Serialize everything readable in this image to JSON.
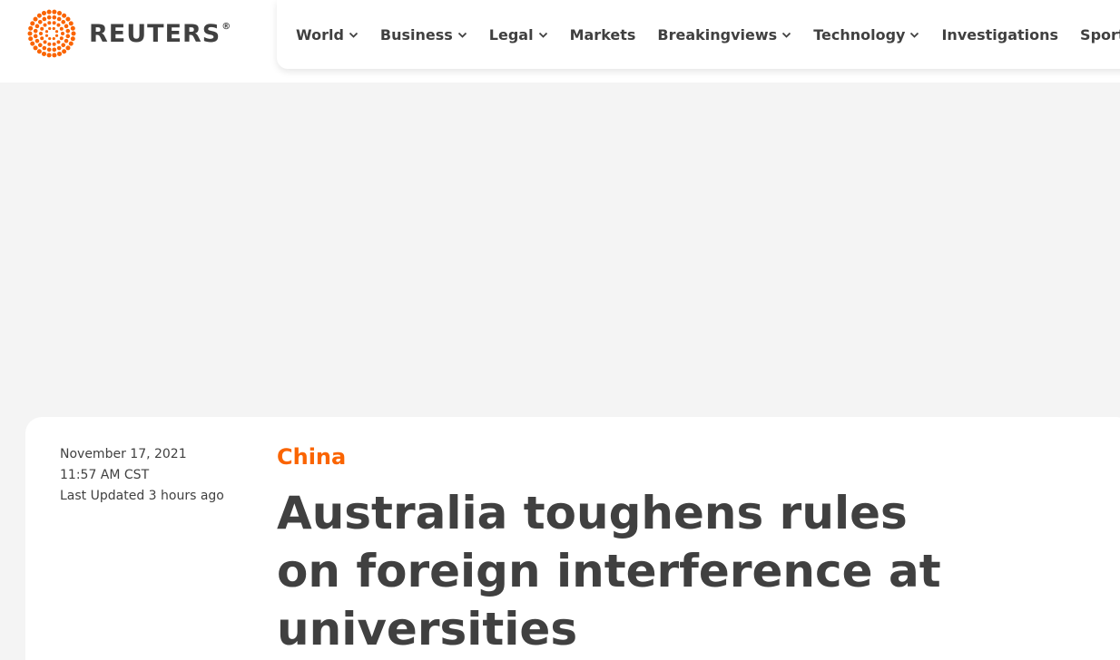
{
  "header": {
    "logo_text": "REUTERS",
    "logo_mark": "®",
    "brand_color": "#fa6400"
  },
  "nav": {
    "items": [
      {
        "label": "World",
        "has_dropdown": true
      },
      {
        "label": "Business",
        "has_dropdown": true
      },
      {
        "label": "Legal",
        "has_dropdown": true
      },
      {
        "label": "Markets",
        "has_dropdown": false
      },
      {
        "label": "Breakingviews",
        "has_dropdown": true
      },
      {
        "label": "Technology",
        "has_dropdown": true
      },
      {
        "label": "Investigations",
        "has_dropdown": false
      },
      {
        "label": "Sports",
        "has_dropdown": true
      }
    ]
  },
  "article": {
    "date": "November 17, 2021",
    "time": "11:57 AM CST",
    "updated_label": "Last Updated",
    "updated_value": "3 hours ago",
    "section": "China",
    "headline": "Australia toughens rules on foreign interference at universities"
  }
}
